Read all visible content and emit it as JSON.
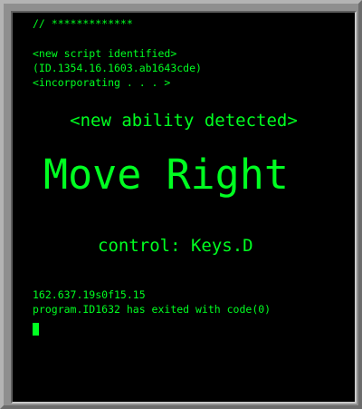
{
  "console": {
    "comment": "// *************",
    "header_lines": [
      "<new script identified>",
      "(ID.1354.16.1603.ab1643cde)",
      "<incorporating . . . >"
    ],
    "detected_text": "<new ability detected>",
    "ability_name": "Move Right",
    "control_text": "control: Keys.D",
    "footer_lines": [
      "162.637.19s0f15.15",
      "program.ID1632 has exited with code(0)"
    ]
  },
  "colors": {
    "terminal_text": "#00ff21",
    "terminal_background": "#000000",
    "frame": "#8f8f8f"
  }
}
